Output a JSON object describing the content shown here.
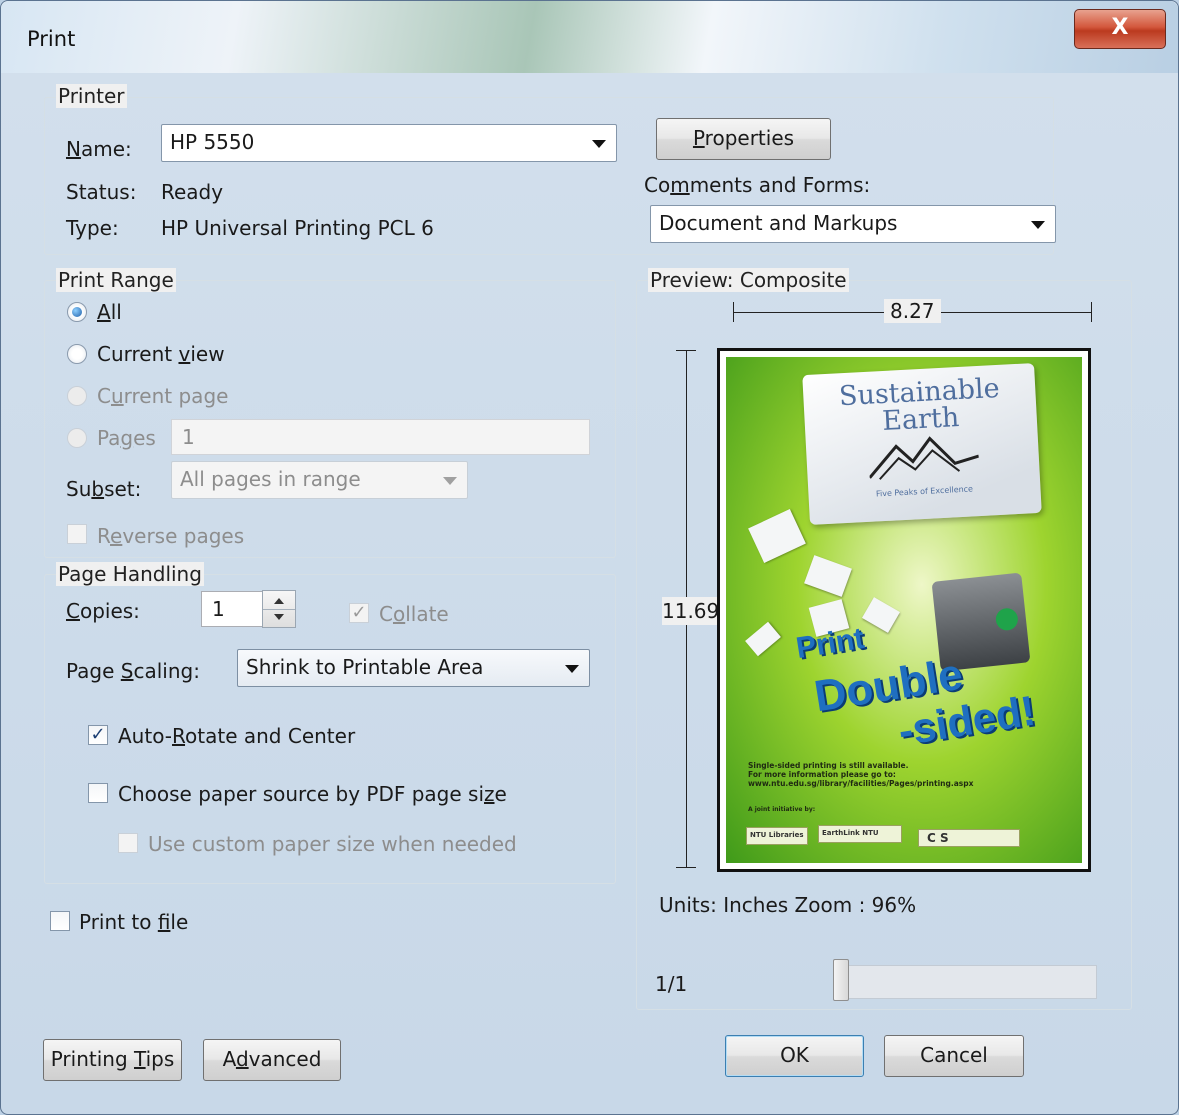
{
  "window": {
    "title": "Print",
    "close_glyph": "X"
  },
  "printer": {
    "legend": "Printer",
    "name_label": "Name:",
    "name_value": "HP 5550",
    "status_label": "Status:",
    "status_value": "Ready",
    "type_label": "Type:",
    "type_value": "HP Universal Printing PCL 6",
    "properties_button": "Properties",
    "comments_label": "Comments and Forms:",
    "comments_value": "Document and Markups"
  },
  "print_range": {
    "legend": "Print Range",
    "all": "All",
    "current_view": "Current view",
    "current_page": "Current page",
    "pages": "Pages",
    "pages_value": "1",
    "subset_label": "Subset:",
    "subset_value": "All pages in range",
    "reverse_pages": "Reverse pages",
    "selected": "All"
  },
  "page_handling": {
    "legend": "Page Handling",
    "copies_label": "Copies:",
    "copies_value": "1",
    "collate_label": "Collate",
    "collate_checked": true,
    "scaling_label": "Page Scaling:",
    "scaling_value": "Shrink to Printable Area",
    "auto_rotate_label": "Auto-Rotate and Center",
    "auto_rotate_checked": true,
    "paper_source_label": "Choose paper source by PDF page size",
    "paper_source_checked": false,
    "custom_paper_label": "Use custom paper size when needed",
    "custom_paper_checked": false
  },
  "print_to_file": {
    "label": "Print to file",
    "checked": false
  },
  "preview": {
    "legend": "Preview: Composite",
    "width": "8.27",
    "height": "11.69",
    "units_zoom": "Units: Inches Zoom :  96%",
    "page_counter": "1/1",
    "poster": {
      "title_line1": "Sustainable",
      "title_line2": "Earth",
      "tagline": "Five Peaks of Excellence",
      "word1": "Print",
      "word2": "Double",
      "word3": "-sided!",
      "note_line1": "Single-sided printing is still available.",
      "note_line2": "For more information please go to:",
      "note_line3": "www.ntu.edu.sg/library/facilities/Pages/printing.aspx",
      "initiative": "A joint initiative by:",
      "logo1": "NTU Libraries",
      "logo2": "EarthLink NTU",
      "logo3": "C S"
    }
  },
  "buttons": {
    "printing_tips": "Printing Tips",
    "advanced": "Advanced",
    "ok": "OK",
    "cancel": "Cancel"
  },
  "colors": {
    "dialog_bg": "#f0f0f0",
    "close_button": "#c9452a",
    "radio_selected": "#1f5fa8",
    "poster_green": "#9ed42f",
    "poster_blue": "#1f6fc0"
  }
}
